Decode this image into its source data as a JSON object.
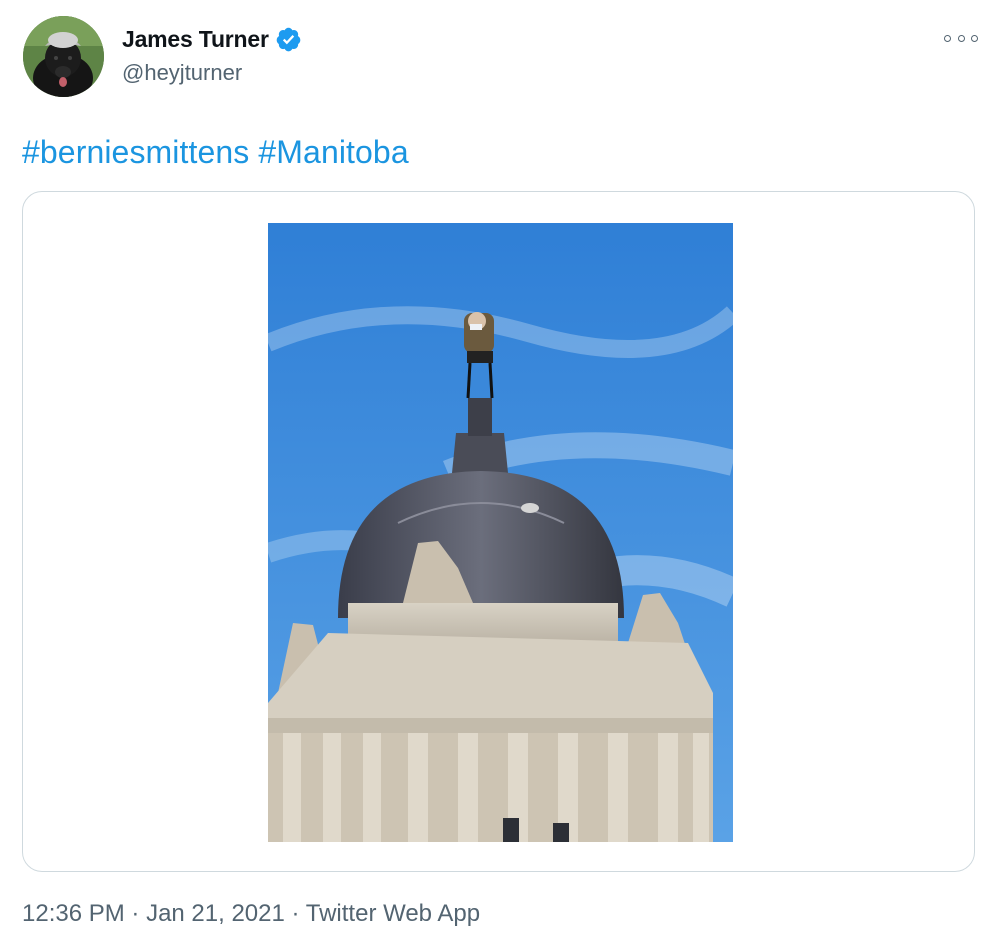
{
  "author": {
    "name": "James Turner",
    "handle": "@heyjturner",
    "verified_icon": "verified-badge-icon",
    "avatar_icon": "dog-avatar"
  },
  "more_icon": "more-options-icon",
  "tweet": {
    "hashtags": [
      "#berniesmittens",
      "#Manitoba"
    ]
  },
  "media": {
    "icon": "photo-capitol-dome-with-seated-figure"
  },
  "meta": {
    "time": "12:36 PM",
    "separator1": " · ",
    "date": "Jan 21, 2021",
    "separator2": " · ",
    "source": "Twitter Web App"
  },
  "colors": {
    "link": "#1b95e0",
    "muted": "#536471",
    "verified": "#1d9bf0"
  }
}
